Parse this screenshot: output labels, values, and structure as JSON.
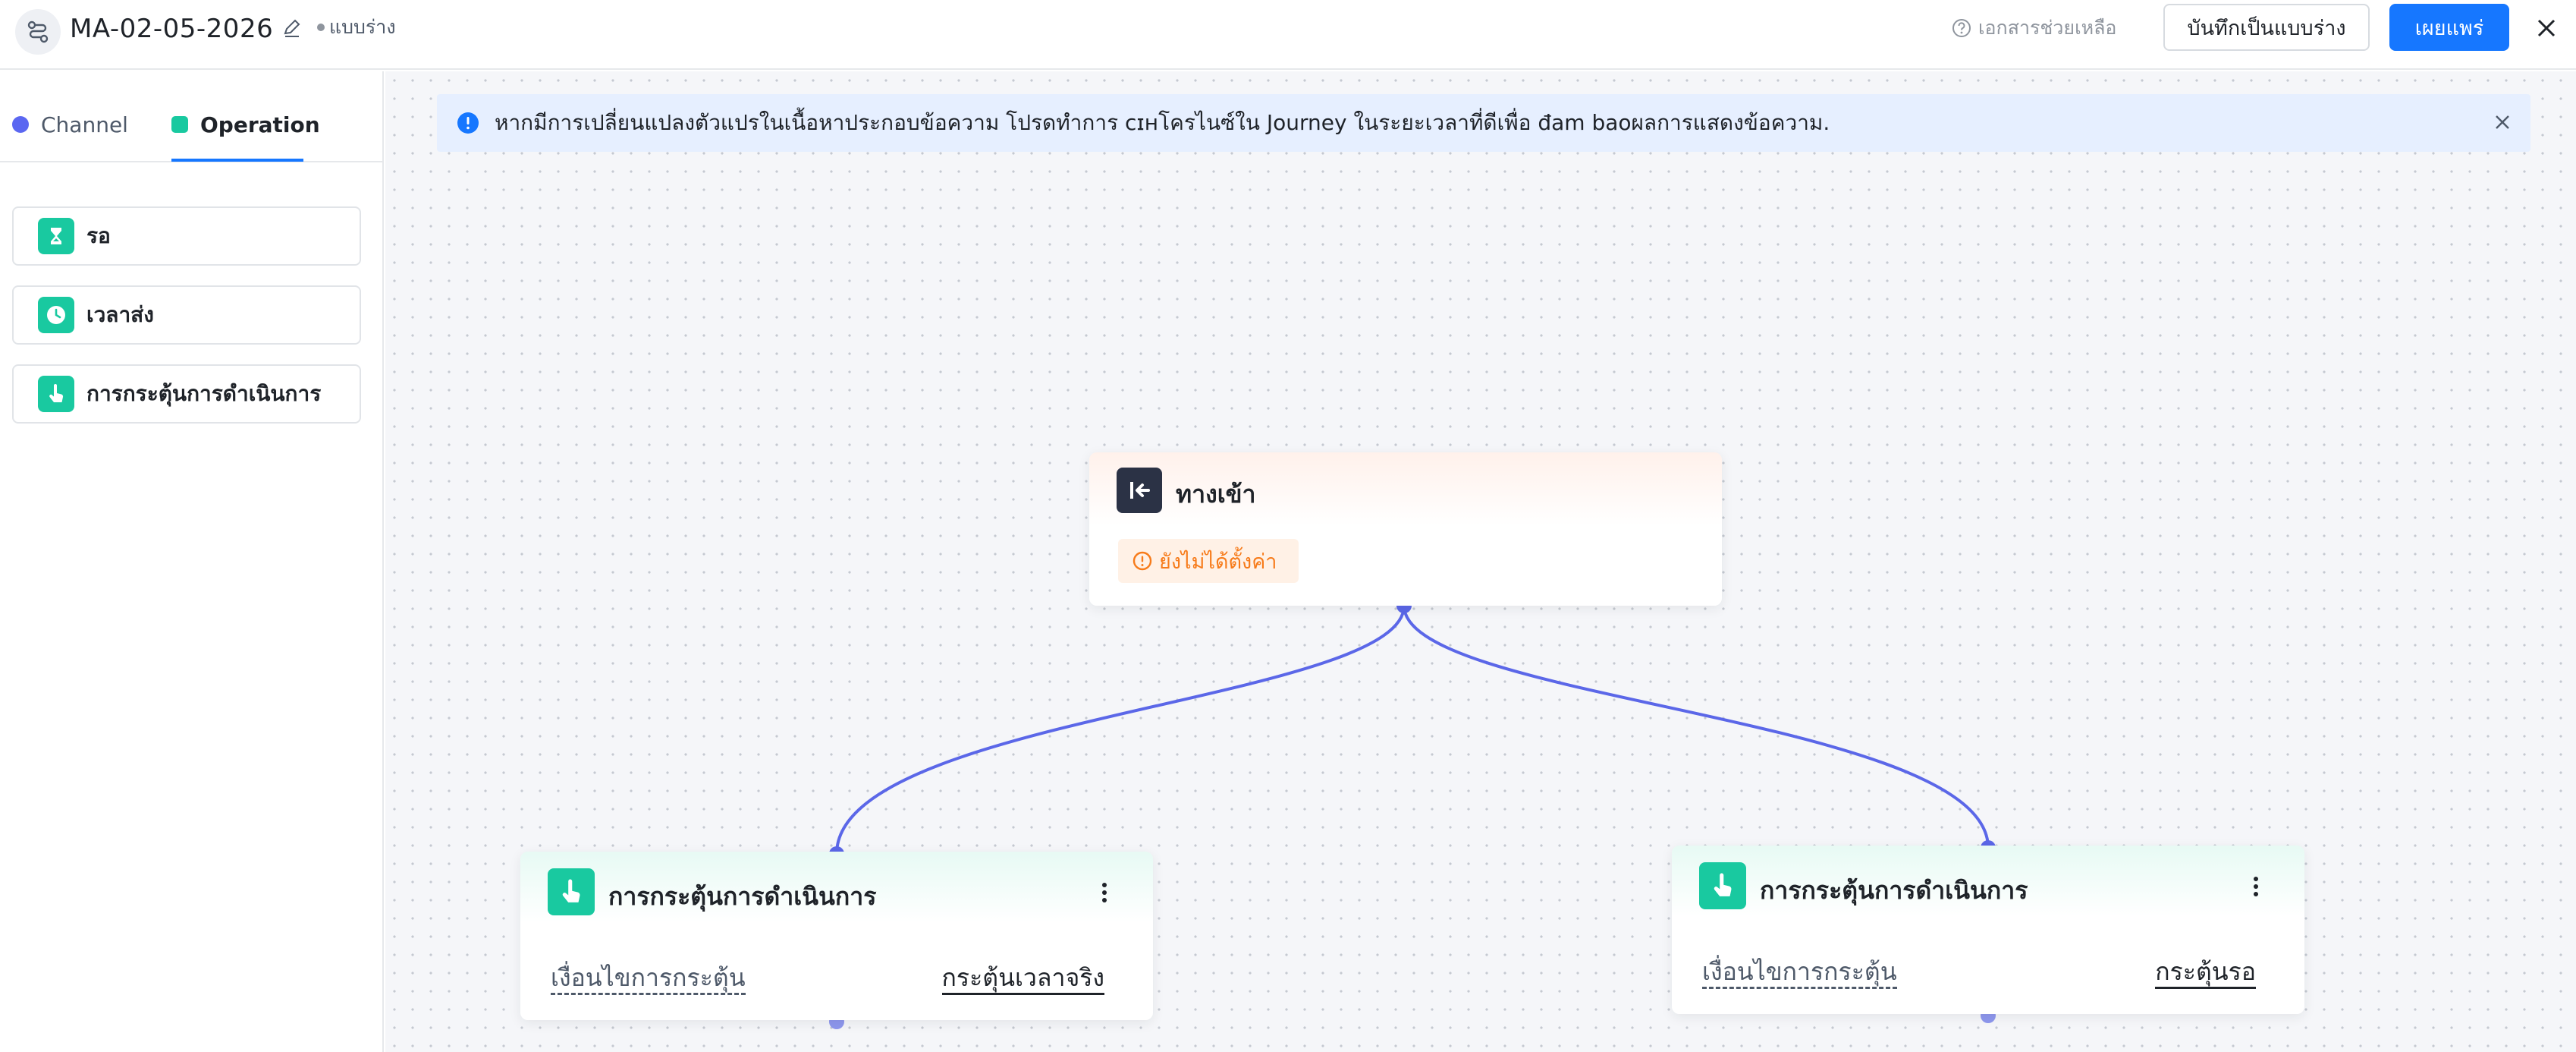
{
  "header": {
    "title": "MA-02-05-2026",
    "status": "แบบร่าง",
    "help_label": "เอกสารช่วยเหลือ",
    "save_draft_label": "บันทึกเป็นแบบร่าง",
    "publish_label": "เผยแพร่"
  },
  "sidebar": {
    "tabs": [
      {
        "label": "Channel",
        "active": false
      },
      {
        "label": "Operation",
        "active": true
      }
    ],
    "items": [
      {
        "label": "รอ",
        "icon": "hourglass-icon"
      },
      {
        "label": "เวลาส่ง",
        "icon": "clock-icon"
      },
      {
        "label": "การกระตุ้นการดำเนินการ",
        "icon": "tap-hand-icon"
      }
    ]
  },
  "canvas": {
    "banner_text": "หากมีการเปลี่ยนแปลงตัวแปรในเนื้อหาประกอบข้อความ โปรดทำการ cɪнโครไนซ์ใน Journey ในระยะเวลาที่ดีเพื่อ đam baoผลการแสดงข้อความ.",
    "entry_node": {
      "title": "ทางเข้า",
      "warning": "ยังไม่ได้ตั้งค่า"
    },
    "action_nodes": [
      {
        "title": "การกระตุ้นการดำเนินการ",
        "condition_label": "เงื่อนไขการกระตุ้น",
        "condition_value": "กระตุ้นเวลาจริง"
      },
      {
        "title": "การกระตุ้นการดำเนินการ",
        "condition_label": "เงื่อนไขการกระตุ้น",
        "condition_value": "กระตุ้นรอ"
      }
    ]
  },
  "colors": {
    "accent": "#1677ff",
    "connector": "#5b67e8",
    "operation": "#19c9a0",
    "warning": "#f77b1a"
  }
}
